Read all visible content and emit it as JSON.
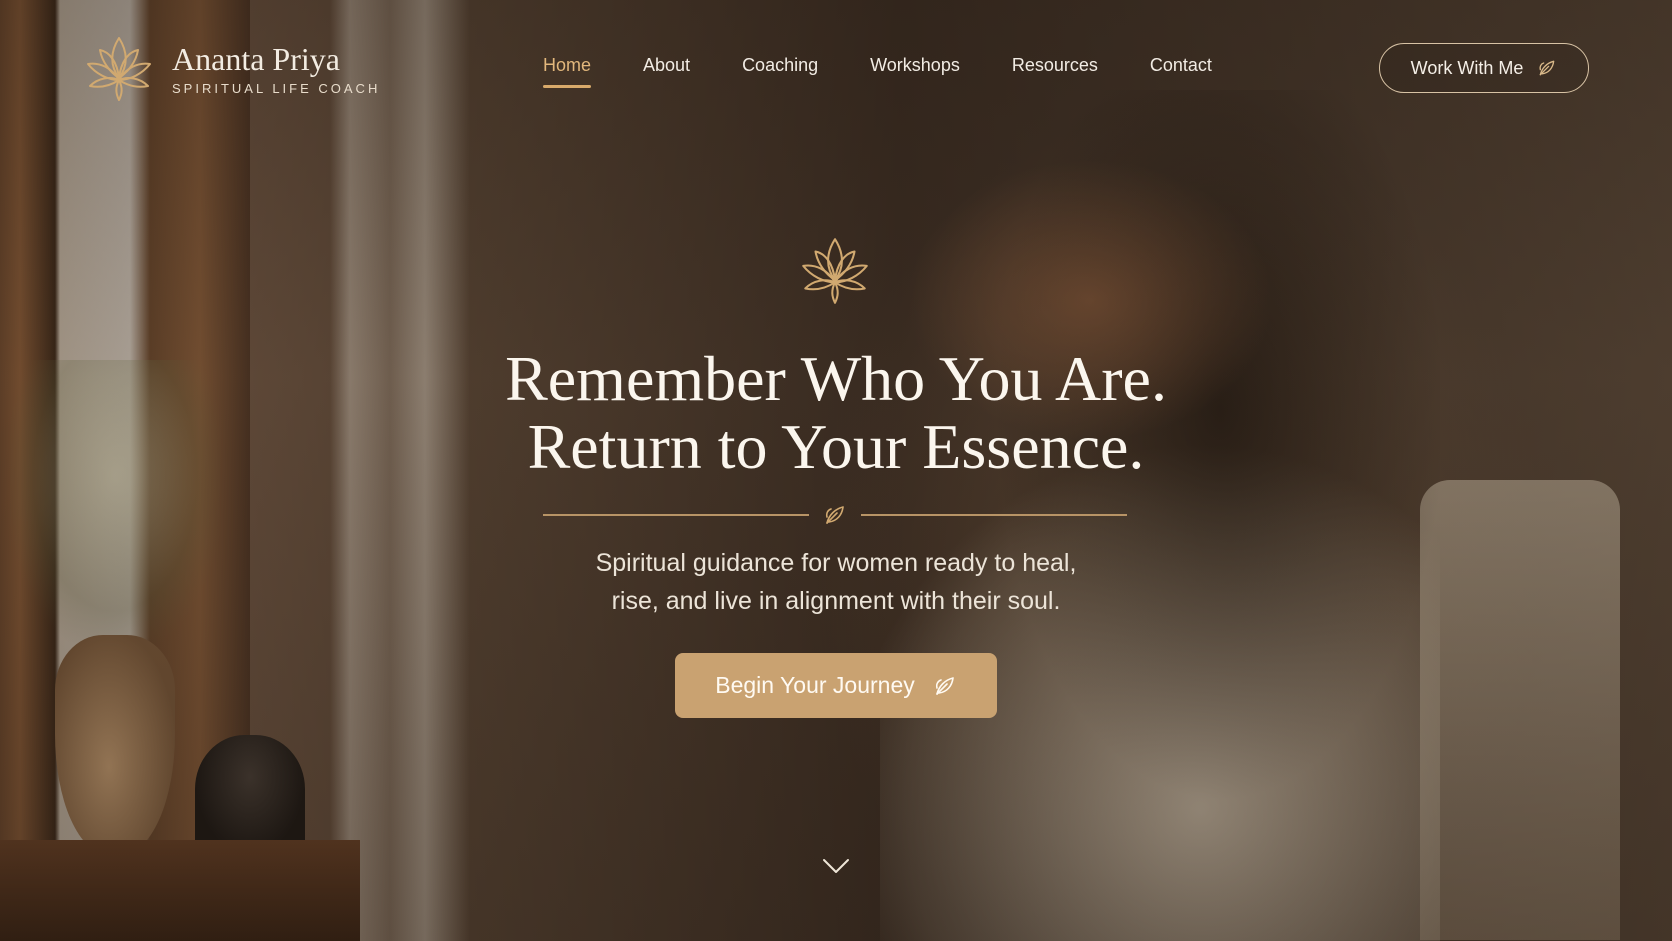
{
  "brand": {
    "name": "Ananta Priya",
    "tagline": "SPIRITUAL LIFE COACH",
    "logo_icon": "lotus-icon"
  },
  "nav": {
    "items": [
      {
        "label": "Home",
        "active": true
      },
      {
        "label": "About",
        "active": false
      },
      {
        "label": "Coaching",
        "active": false
      },
      {
        "label": "Workshops",
        "active": false
      },
      {
        "label": "Resources",
        "active": false
      },
      {
        "label": "Contact",
        "active": false
      }
    ]
  },
  "header_cta": {
    "label": "Work With Me",
    "icon": "leaf-icon"
  },
  "hero": {
    "icon": "lotus-icon",
    "headline_line1": "Remember Who You Are.",
    "headline_line2": "Return to Your Essence.",
    "divider_icon": "leaf-icon",
    "subtext_line1": "Spiritual guidance for women ready to heal,",
    "subtext_line2": "rise, and live in alignment with their soul.",
    "cta_label": "Begin Your Journey",
    "cta_icon": "leaf-icon",
    "scroll_icon": "chevron-down-icon"
  },
  "colors": {
    "accent_gold": "#c9a271",
    "nav_active": "#e2b77c",
    "text_light": "#f3ece2"
  }
}
